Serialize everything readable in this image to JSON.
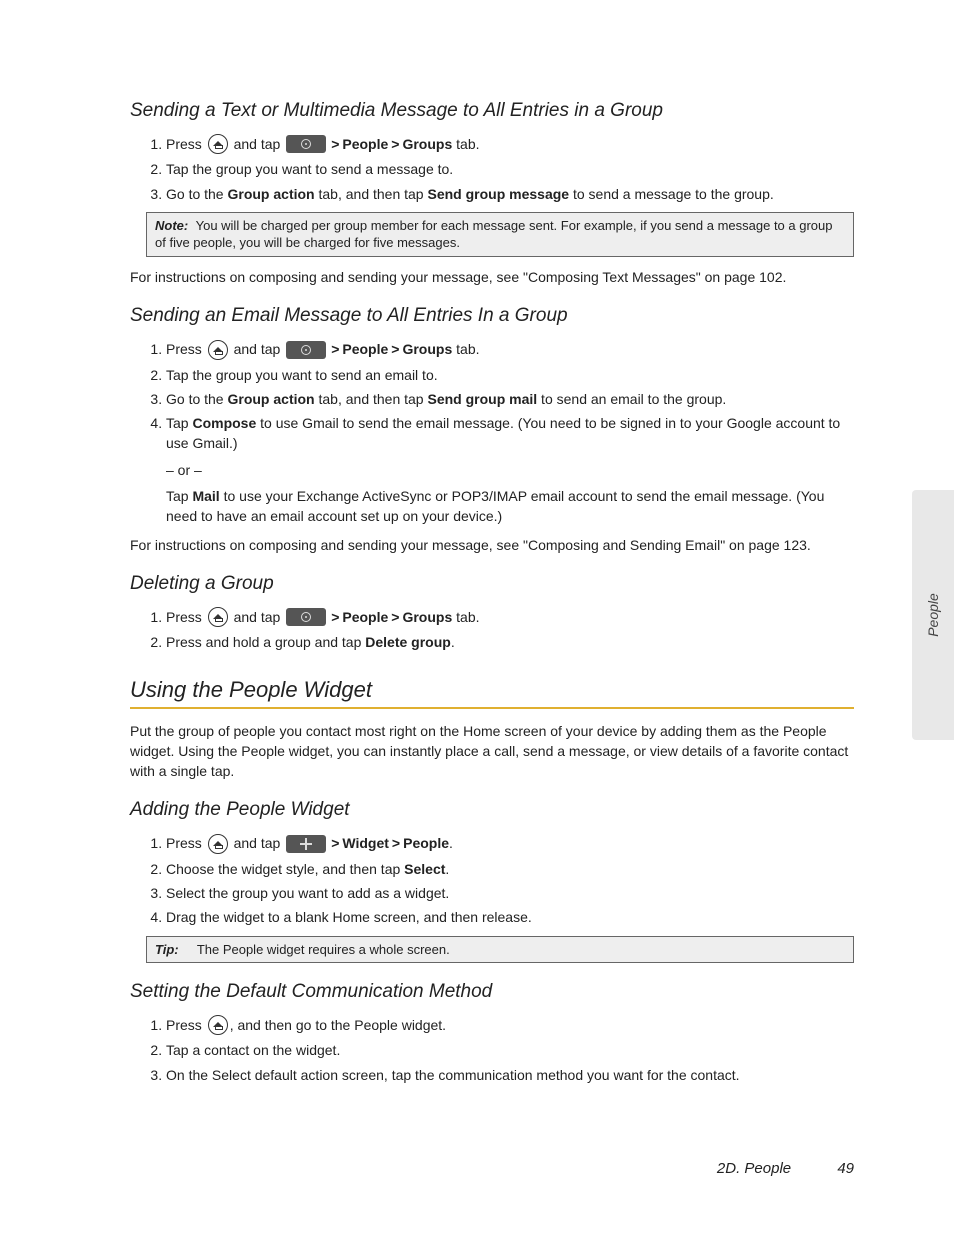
{
  "sideTab": "People",
  "footer": {
    "section": "2D. People",
    "page": "49"
  },
  "s1": {
    "heading": "Sending a Text or Multimedia Message to All Entries in a Group",
    "step1a": "Press ",
    "step1b": " and tap ",
    "people": "People",
    "groups": "Groups",
    "tabWord": " tab.",
    "step2": "Tap the group you want to send a message to.",
    "step3a": "Go to the ",
    "groupAction": "Group action",
    "step3b": " tab, and then tap ",
    "sendGroupMsg": "Send group message",
    "step3c": " to send a message to the group.",
    "noteLabel": "Note:",
    "noteText": "You will be charged per group member for each message sent. For example, if you send a message to a group of five people, you will be charged for five messages.",
    "after": "For instructions on composing and sending your message, see \"Composing Text Messages\" on page 102."
  },
  "s2": {
    "heading": "Sending an Email Message to All Entries In a Group",
    "step1a": "Press ",
    "step1b": " and tap ",
    "people": "People",
    "groups": "Groups",
    "tabWord": " tab.",
    "step2": "Tap the group you want to send an email to.",
    "step3a": "Go to the ",
    "groupAction": "Group action",
    "step3b": " tab, and then tap ",
    "sendGroupMail": "Send group mail",
    "step3c": " to send an email to the group.",
    "step4a": "Tap ",
    "compose": "Compose",
    "step4b": " to use Gmail to send the email message. (You need to be signed in to your Google account to use Gmail.)",
    "or": "– or –",
    "step4c": "Tap ",
    "mail": "Mail",
    "step4d": " to use your Exchange ActiveSync or POP3/IMAP email account to send the email message. (You need to have an email account set up on your device.)",
    "after": "For instructions on composing and sending your message, see \"Composing and Sending Email\" on page 123."
  },
  "s3": {
    "heading": "Deleting a Group",
    "step1a": "Press ",
    "step1b": " and tap ",
    "people": "People",
    "groups": "Groups",
    "tabWord": " tab.",
    "step2a": "Press and hold a group and tap ",
    "deleteGroup": "Delete group",
    "step2b": "."
  },
  "s4": {
    "heading": "Using the People Widget",
    "intro": "Put the group of people you contact most right on the Home screen of your device by adding them as the People widget. Using the People widget, you can instantly place a call, send a message, or view details of a favorite contact with a single tap."
  },
  "s5": {
    "heading": "Adding the People Widget",
    "step1a": "Press ",
    "step1b": " and tap ",
    "widget": "Widget",
    "people": "People",
    "dot": ".",
    "step2a": "Choose the widget style, and then tap ",
    "select": "Select",
    "step2b": ".",
    "step3": "Select the group you want to add as a widget.",
    "step4": "Drag the widget to a blank Home screen, and then release.",
    "tipLabel": "Tip:",
    "tipText": "The People widget requires a whole screen."
  },
  "s6": {
    "heading": "Setting the Default Communication Method",
    "step1a": "Press ",
    "step1b": ", and then go to the People widget.",
    "step2": "Tap a contact on the widget.",
    "step3": "On the Select default action screen, tap the communication method you want for the contact."
  }
}
